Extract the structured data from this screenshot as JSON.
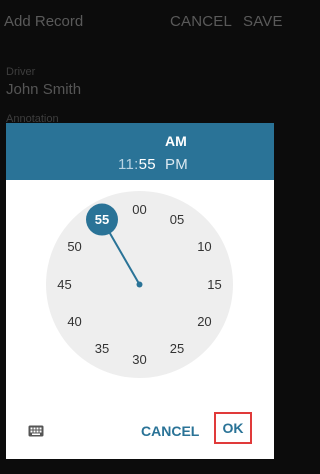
{
  "app": {
    "title": "Add Record",
    "cancel_label": "CANCEL",
    "save_label": "SAVE",
    "fields": [
      {
        "label": "Driver",
        "value": "John Smith"
      },
      {
        "label": "Annotation",
        "value": ""
      }
    ]
  },
  "dialog": {
    "am_label": "AM",
    "hour": "11",
    "separator": ":",
    "minute": "55",
    "pm_label": "PM",
    "clock_numbers": [
      "00",
      "05",
      "10",
      "15",
      "20",
      "25",
      "30",
      "35",
      "40",
      "45",
      "50",
      "55"
    ],
    "selected_number": "55",
    "keyboard_icon": "keyboard-icon",
    "cancel_label": "CANCEL",
    "ok_label": "OK"
  },
  "colors": {
    "accent": "#2a7397",
    "clock_face": "#eeeeee",
    "highlight_border": "#e03a3a"
  }
}
